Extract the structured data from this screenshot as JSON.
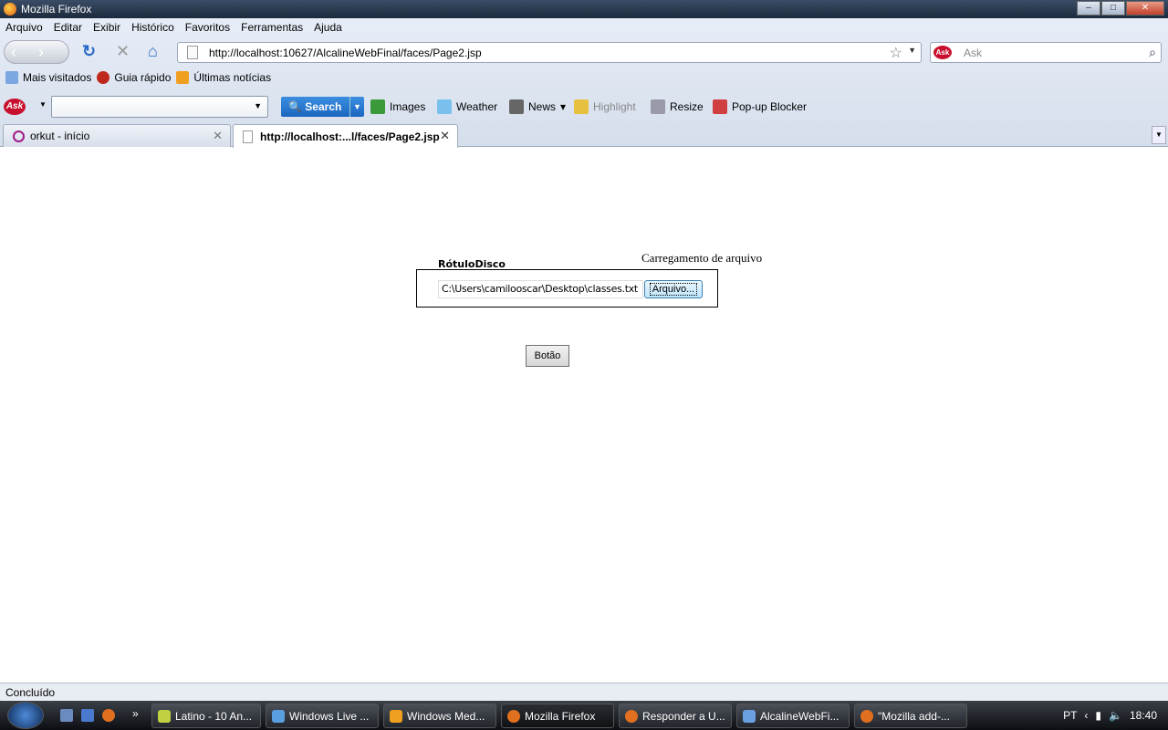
{
  "window": {
    "title": "Mozilla Firefox"
  },
  "menu": [
    "Arquivo",
    "Editar",
    "Exibir",
    "Histórico",
    "Favoritos",
    "Ferramentas",
    "Ajuda"
  ],
  "nav": {
    "url": "http://localhost:10627/AlcalineWebFinal/faces/Page2.jsp",
    "search_placeholder": "Ask"
  },
  "bookmarks": [
    "Mais visitados",
    "Guia rápido",
    "Últimas notícias"
  ],
  "ask_toolbar": {
    "search": "Search",
    "items": [
      "Images",
      "Weather",
      "News",
      "Highlight",
      "Resize",
      "Pop-up Blocker"
    ]
  },
  "tabs": [
    {
      "label": "orkut - início"
    },
    {
      "label": "http://localhost:...l/faces/Page2.jsp"
    }
  ],
  "page": {
    "label": "RótuloDisco",
    "upload_title": "Carregamento de arquivo",
    "file_value": "C:\\Users\\camilooscar\\Desktop\\classes.txt",
    "browse_button": "Arquivo...",
    "button": "Botão"
  },
  "status": "Concluído",
  "taskbar": {
    "tasks": [
      "Latino - 10 An...",
      "Windows Live ...",
      "Windows Med...",
      "Mozilla Firefox",
      "Responder a U...",
      "AlcalineWebFi...",
      "\"Mozilla add-..."
    ],
    "lang": "PT",
    "clock": "18:40"
  }
}
